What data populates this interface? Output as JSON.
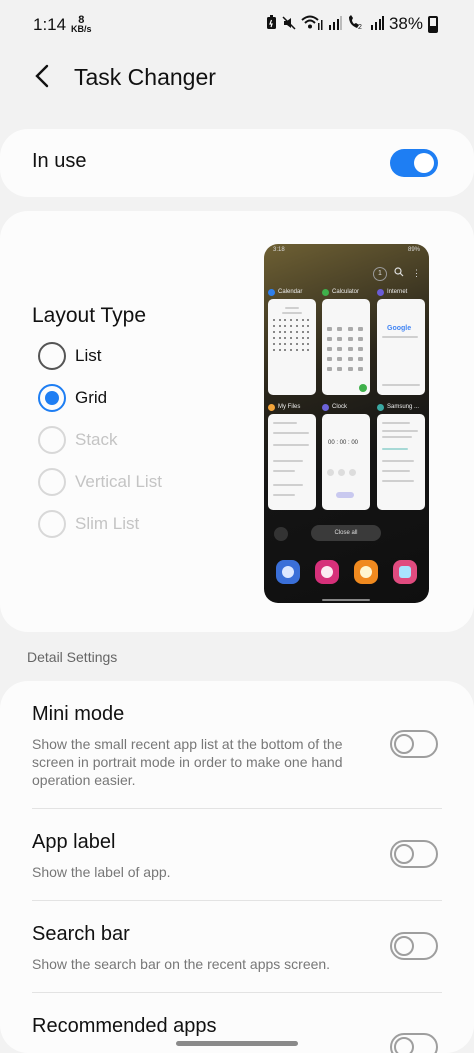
{
  "status": {
    "time": "1:14",
    "speed_value": "8",
    "speed_unit": "KB/s",
    "battery_percent": "38%"
  },
  "header": {
    "title": "Task Changer",
    "back_icon": "back-arrow-icon"
  },
  "in_use": {
    "label": "In use",
    "enabled": true
  },
  "layout": {
    "title": "Layout Type",
    "options": [
      {
        "label": "List",
        "selected": false,
        "enabled": true
      },
      {
        "label": "Grid",
        "selected": true,
        "enabled": true
      },
      {
        "label": "Stack",
        "selected": false,
        "enabled": false
      },
      {
        "label": "Vertical List",
        "selected": false,
        "enabled": false
      },
      {
        "label": "Slim List",
        "selected": false,
        "enabled": false
      }
    ],
    "preview": {
      "time": "3:18",
      "battery": "89%",
      "badge": "1",
      "apps": [
        "Calendar",
        "Calculator",
        "Internet",
        "My Files",
        "Clock",
        "Samsung ..."
      ],
      "search_text": "Google",
      "timer_text": "00 : 00 : 00",
      "close_all": "Close all"
    }
  },
  "detail_settings": {
    "label": "Detail Settings",
    "items": [
      {
        "title": "Mini mode",
        "description": "Show the small recent app list at the bottom of the screen in portrait mode in order to make one hand operation easier.",
        "enabled": false
      },
      {
        "title": "App label",
        "description": "Show the label of app.",
        "enabled": false
      },
      {
        "title": "Search bar",
        "description": "Show the search bar on the recent apps screen.",
        "enabled": false
      },
      {
        "title": "Recommended apps",
        "description": "",
        "enabled": false
      }
    ]
  },
  "colors": {
    "accent": "#1e7ef3",
    "background": "#f2f2f2",
    "card": "#fcfcfc"
  }
}
